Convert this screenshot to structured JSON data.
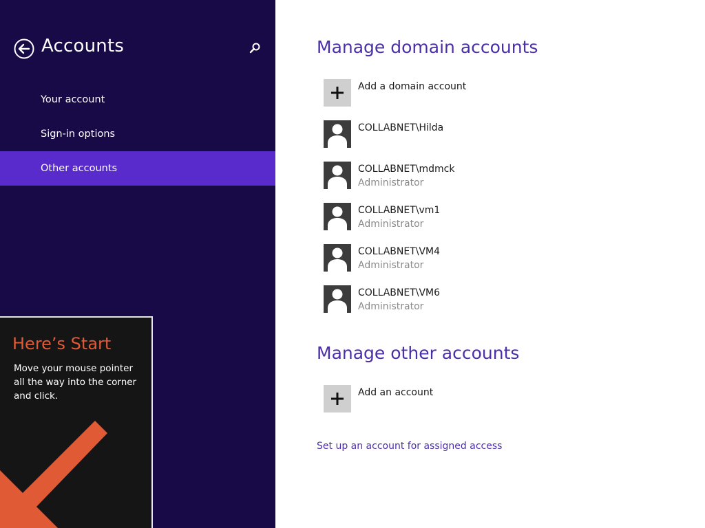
{
  "sidebar": {
    "title": "Accounts",
    "back_icon": "back-arrow-circle-icon",
    "search_icon": "search-icon",
    "items": [
      {
        "label": "Your account",
        "selected": false
      },
      {
        "label": "Sign-in options",
        "selected": false
      },
      {
        "label": "Other accounts",
        "selected": true
      }
    ],
    "colors": {
      "background": "#180a46",
      "selected": "#5a2bcc"
    }
  },
  "start_tip": {
    "title": "Here’s Start",
    "text": "Move your mouse pointer all the way into the corner and click.",
    "arrow_icon": "diagonal-arrow-icon",
    "colors": {
      "title": "#e05a36",
      "arrow": "#e05a36"
    }
  },
  "main": {
    "domain_section": {
      "title": "Manage domain accounts",
      "add_label": "Add a domain account",
      "accounts": [
        {
          "name": "COLLABNET\\Hilda",
          "role": ""
        },
        {
          "name": "COLLABNET\\mdmck",
          "role": "Administrator"
        },
        {
          "name": "COLLABNET\\vm1",
          "role": "Administrator"
        },
        {
          "name": "COLLABNET\\VM4",
          "role": "Administrator"
        },
        {
          "name": "COLLABNET\\VM6",
          "role": "Administrator"
        }
      ]
    },
    "other_section": {
      "title": "Manage other accounts",
      "add_label": "Add an account"
    },
    "assigned_access_link": "Set up an account for assigned access",
    "colors": {
      "accent": "#4b2fa8"
    }
  }
}
